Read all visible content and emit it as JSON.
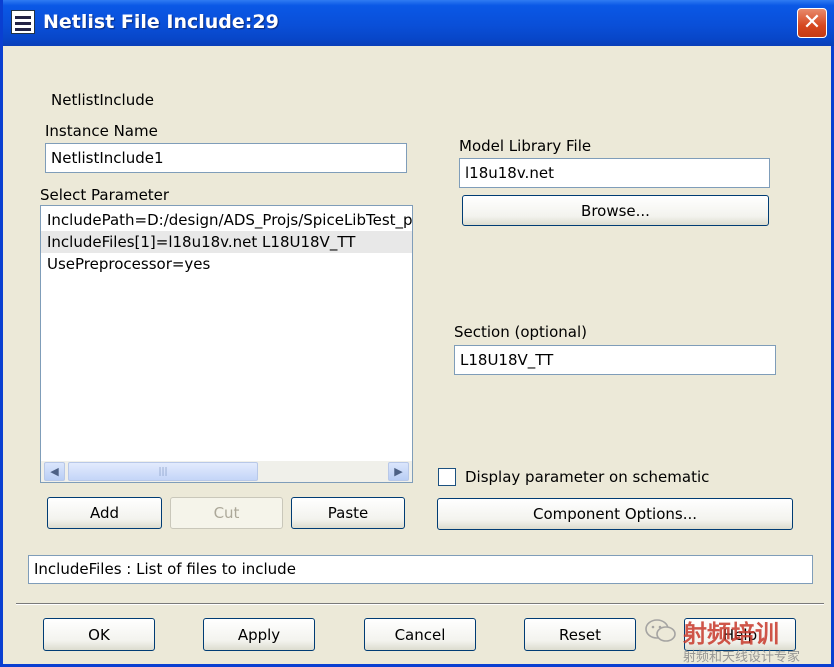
{
  "window": {
    "title": "Netlist File Include:29",
    "close_glyph": "✕"
  },
  "component": {
    "type_label": "NetlistInclude"
  },
  "instance": {
    "label": "Instance Name",
    "value": "NetlistInclude1"
  },
  "parameters": {
    "label": "Select Parameter",
    "items": [
      "IncludePath=D:/design/ADS_Projs/SpiceLibTest_p",
      "IncludeFiles[1]=l18u18v.net L18U18V_TT",
      "UsePreprocessor=yes"
    ],
    "selected_index": 1,
    "scroll_left": "◀",
    "scroll_right": "▶",
    "scroll_grip": "|||"
  },
  "buttons": {
    "add": "Add",
    "cut": "Cut",
    "paste": "Paste",
    "browse": "Browse...",
    "component_options": "Component Options...",
    "ok": "OK",
    "apply": "Apply",
    "cancel": "Cancel",
    "reset": "Reset",
    "help": "Help"
  },
  "model_library": {
    "label": "Model Library File",
    "value": "l18u18v.net"
  },
  "section": {
    "label": "Section (optional)",
    "value": "L18U18V_TT"
  },
  "display_parameter": {
    "label": "Display parameter on schematic",
    "checked": false
  },
  "status": {
    "text": "IncludeFiles : List of files to include"
  },
  "watermark": {
    "main": "射频培训",
    "sub": "射频和天线设计专家"
  },
  "colors": {
    "titlebar": "#0a58e6",
    "close": "#d6471f",
    "dialog_bg": "#ece9d8",
    "button_border": "#003c74"
  }
}
